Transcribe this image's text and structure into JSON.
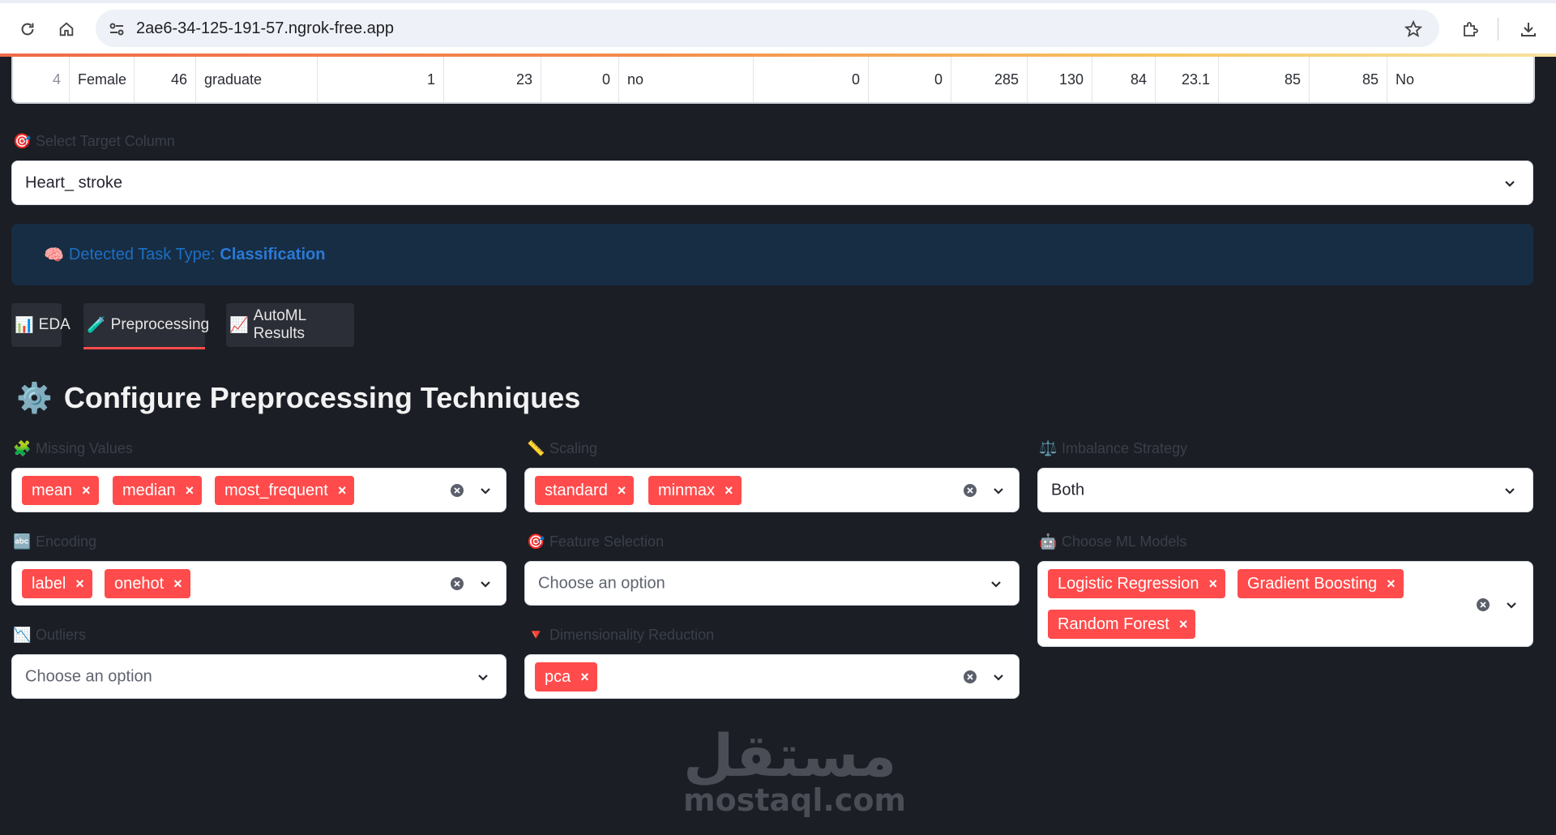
{
  "browser": {
    "url": "2ae6-34-125-191-57.ngrok-free.app"
  },
  "table_row": [
    "4",
    "Female",
    "46",
    "graduate",
    "1",
    "23",
    "0",
    "no",
    "0",
    "0",
    "285",
    "130",
    "84",
    "23.1",
    "85",
    "85",
    "No"
  ],
  "target": {
    "label": "Select Target Column",
    "value": "Heart_ stroke",
    "icon": "target-icon"
  },
  "task": {
    "prefix": "Detected Task Type:",
    "value": "Classification",
    "icon": "brain-icon"
  },
  "tabs": [
    {
      "label": "EDA",
      "icon": "bar-chart-icon"
    },
    {
      "label": "Preprocessing",
      "icon": "brush-icon"
    },
    {
      "label": "AutoML Results",
      "icon": "line-chart-icon"
    }
  ],
  "heading": {
    "text": "Configure Preprocessing Techniques",
    "icon": "gear-icon"
  },
  "widgets": {
    "missing_values": {
      "label": "Missing Values",
      "icon": "puzzle-icon",
      "tags": [
        "mean",
        "median",
        "most_frequent"
      ]
    },
    "scaling": {
      "label": "Scaling",
      "icon": "ruler-icon",
      "tags": [
        "standard",
        "minmax"
      ]
    },
    "imbalance": {
      "label": "Imbalance Strategy",
      "icon": "scales-icon",
      "value": "Both"
    },
    "encoding": {
      "label": "Encoding",
      "icon": "abc-icon",
      "tags": [
        "label",
        "onehot"
      ]
    },
    "feature_selection": {
      "label": "Feature Selection",
      "icon": "target-icon",
      "placeholder": "Choose an option"
    },
    "models": {
      "label": "Choose ML Models",
      "icon": "robot-icon",
      "tags": [
        "Logistic Regression",
        "Gradient Boosting",
        "Random Forest"
      ]
    },
    "outliers": {
      "label": "Outliers",
      "icon": "chart-down-icon",
      "placeholder": "Choose an option"
    },
    "dim_reduction": {
      "label": "Dimensionality Reduction",
      "icon": "triangle-down-icon",
      "tags": [
        "pca"
      ]
    }
  },
  "watermark": {
    "arabic": "مستقل",
    "latin": "mostaql.com"
  },
  "colors": {
    "background": "#1b1e25",
    "tag": "#ff4b4b",
    "info_bg": "#172d44",
    "info_text": "#1c6fc4"
  }
}
